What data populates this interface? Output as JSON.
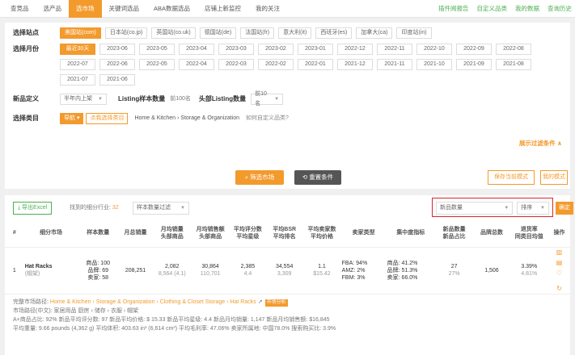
{
  "nav": {
    "tabs": [
      "查竞品",
      "选产品",
      "选市场",
      "关键词选品",
      "ABA数据选品",
      "店铺上新监控",
      "我的关注"
    ],
    "active_index": 2,
    "right_links": [
      "插件阅报告",
      "自定义品类",
      "我的数据",
      "查询历史"
    ]
  },
  "filters": {
    "site_label": "选择站点",
    "sites": [
      "美国站(com)",
      "日本站(co.jp)",
      "英国站(co.uk)",
      "德国站(de)",
      "法国站(fr)",
      "意大利(it)",
      "西班牙(es)",
      "加拿大(ca)",
      "印度站(in)"
    ],
    "month_label": "选择月份",
    "months_row1": [
      "最近30天",
      "2023-06",
      "2023-05",
      "2023-04",
      "2023-03",
      "2023-02",
      "2023-01",
      "2022-12",
      "2022-11",
      "2022-10",
      "2022-09",
      "2022-08",
      "2022-07"
    ],
    "months_row2": [
      "2022-06",
      "2022-05",
      "2022-04",
      "2022-03",
      "2022-02",
      "2022-01",
      "2021-12",
      "2021-11",
      "2021-10",
      "2021-09",
      "2021-08",
      "2021-07",
      "2021-06"
    ],
    "newdef_label": "新品定义",
    "newdef_value": "半年内上架",
    "listing_label": "Listing样本数量",
    "listing_value": "前100名",
    "head_label": "头部Listing数量",
    "head_value": "前10名",
    "category_label": "选择类目",
    "nav_btn": "导航",
    "choose_btn": "点我选择类目",
    "breadcrumb": "Home & Kitchen › Storage & Organization",
    "custom_link": "如何自定义品类?",
    "expand": "展示过滤条件 ∧",
    "search_btn": "筛选市场",
    "reset_btn": "重置条件",
    "save_mode": "保存当前模式",
    "my_mode": "我的模式"
  },
  "results": {
    "export": "导出Excel",
    "found_prefix": "找到的细分行业:",
    "found_count": "32",
    "sample_filter": "样本数量过滤",
    "sort_field": "新品数量",
    "sort_order": "排序",
    "confirm": "确定",
    "headers": [
      [
        "#"
      ],
      [
        "细分市场"
      ],
      [
        "样本数量"
      ],
      [
        "月总销量"
      ],
      [
        "月均销量",
        "头部商品"
      ],
      [
        "月均销售额",
        "头部商品"
      ],
      [
        "平均评分数",
        "平均星级"
      ],
      [
        "平均BSR",
        "平均排名"
      ],
      [
        "平均卖家数",
        "平均价格"
      ],
      [
        "卖家类型"
      ],
      [
        "集中度指标"
      ],
      [
        "新品数量",
        "新品占比"
      ],
      [
        "品牌总数"
      ],
      [
        "退货率",
        "同类目均值"
      ],
      [
        "操作"
      ]
    ],
    "row": {
      "index": "1",
      "market": "Hat Racks",
      "market_sub": "(帽架)",
      "samples": [
        "商品: 100",
        "品牌: 69",
        "卖家: 58"
      ],
      "monthly_total": "208,251",
      "avg_sales": "2,082",
      "avg_sales_sub": "8,564 (4.1)",
      "avg_revenue": "30,864",
      "avg_revenue_sub": "110,701",
      "avg_reviews": "2,385",
      "avg_rating": "4.4",
      "avg_bsr": "34,554",
      "avg_bsr_sub": "3,309",
      "avg_sellers": "1.1",
      "avg_price": "$15.42",
      "seller_types": [
        "FBA: 94%",
        "AMZ: 2%",
        "FBM: 3%"
      ],
      "concentration": [
        "商品: 41.2%",
        "品牌: 51.3%",
        "卖家: 66.0%"
      ],
      "new_count": "27",
      "new_ratio": "27%",
      "brands": "1,506",
      "return_rate": "3.39%",
      "return_avg": "4.81%"
    },
    "details": {
      "path_label": "完整市场路径:",
      "path": "Home & Kitchen › Storage & Organization › Clothing & Closet Storage › Hat Racks",
      "path_tag": "市场分析",
      "cn_path": "市场路径(中文): 家居用品 厨房 › 储存 › 衣服 › 帽架",
      "line1": "A+商品占比: 92%   新品平均评分数: 97   新品平均价格: $ 15.33   新品平均星级: 4.4   新品月均销量: 1,147   新品月均销售额: $16,845",
      "line2": "平均重量: 9.66 pounds (4,362 g)   平均体积: 403.63 in³ (6,614 cm³)   平均毛利率: 47.06%   卖家所属地: 中国78.0%   搜索购买比: 3.9%"
    }
  }
}
